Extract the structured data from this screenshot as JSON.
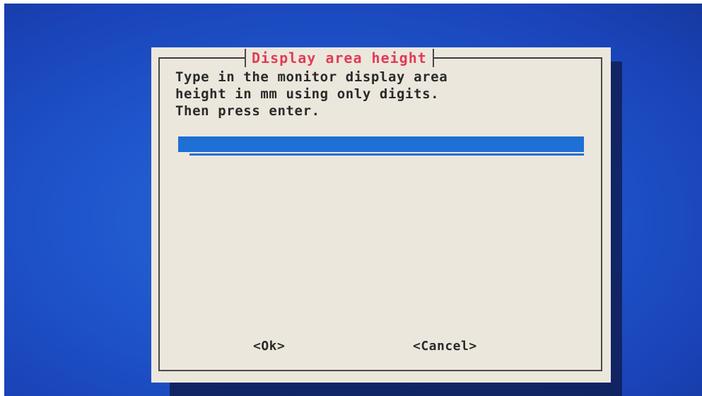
{
  "dialog": {
    "title": "Display area height",
    "prompt": "Type in the monitor display area\nheight in mm using only digits.\nThen press enter.",
    "input_value": ""
  },
  "buttons": {
    "ok_label": "<Ok>",
    "cancel_label": "<Cancel>"
  },
  "colors": {
    "background": "#1f55cc",
    "dialog": "#ece7dd",
    "title": "#e03c56",
    "input": "#1e6fd6",
    "text": "#2a2a2a"
  }
}
